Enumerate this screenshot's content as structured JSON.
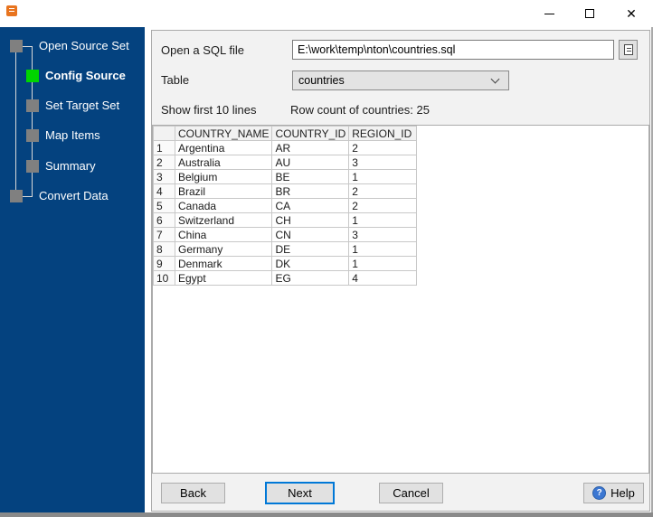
{
  "window": {
    "close_glyph": "✕"
  },
  "sidebar": {
    "steps": [
      {
        "label": "Open Source Set"
      },
      {
        "label": "Config Source"
      },
      {
        "label": "Set Target Set"
      },
      {
        "label": "Map Items"
      },
      {
        "label": "Summary"
      },
      {
        "label": "Convert Data"
      }
    ],
    "colors": {
      "background": "#04427F",
      "active_square": "#00D500",
      "inactive_square": "#808080"
    }
  },
  "form": {
    "sql_file": {
      "label": "Open a SQL file",
      "value": "E:\\work\\temp\\nton\\countries.sql"
    },
    "table": {
      "label": "Table",
      "value": "countries"
    },
    "show_lines_label": "Show first 10 lines",
    "row_count_label": "Row count of countries: 25"
  },
  "grid": {
    "headers": [
      "",
      "COUNTRY_NAME",
      "COUNTRY_ID",
      "REGION_ID"
    ],
    "rows": [
      [
        "1",
        "Argentina",
        "AR",
        "2"
      ],
      [
        "2",
        "Australia",
        "AU",
        "3"
      ],
      [
        "3",
        "Belgium",
        "BE",
        "1"
      ],
      [
        "4",
        "Brazil",
        "BR",
        "2"
      ],
      [
        "5",
        "Canada",
        "CA",
        "2"
      ],
      [
        "6",
        "Switzerland",
        "CH",
        "1"
      ],
      [
        "7",
        "China",
        "CN",
        "3"
      ],
      [
        "8",
        "Germany",
        "DE",
        "1"
      ],
      [
        "9",
        "Denmark",
        "DK",
        "1"
      ],
      [
        "10",
        "Egypt",
        "EG",
        "4"
      ]
    ]
  },
  "buttons": {
    "back": "Back",
    "next": "Next",
    "cancel": "Cancel",
    "help": "Help",
    "help_glyph": "?"
  },
  "colors": {
    "next_border": "#0078D7"
  }
}
